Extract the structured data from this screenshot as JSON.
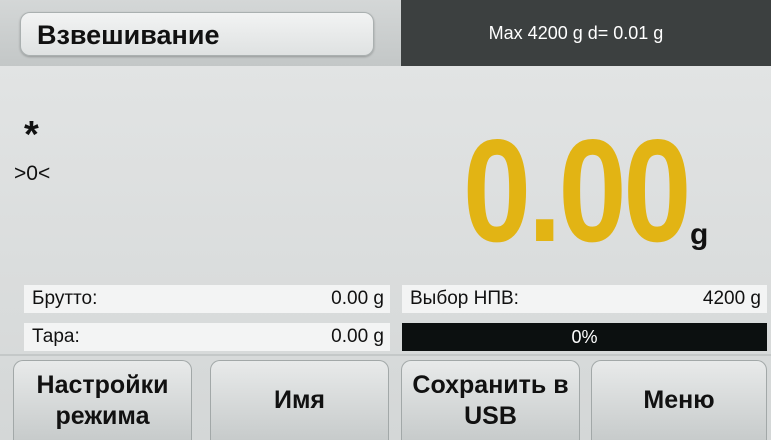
{
  "header": {
    "mode_title": "Взвешивание",
    "capacity": "Max 4200 g   d= 0.01 g"
  },
  "indicators": {
    "stable": "*",
    "center_of_zero": ">0<"
  },
  "display": {
    "weight": "0.00",
    "unit": "g",
    "color": "#e2b414"
  },
  "info": {
    "gross_label": "Брутто:",
    "gross_value": "0.00 g",
    "tare_label": "Тара:",
    "tare_value": "0.00 g",
    "threshold_label": "Выбор НПВ:",
    "threshold_value": "4200 g",
    "capacity_used_text": "0%",
    "capacity_used_fraction": 0
  },
  "buttons": {
    "mode_settings": "Настройки\nрежима",
    "name": "Имя",
    "save_usb": "Сохранить в\nUSB",
    "menu": "Меню"
  }
}
